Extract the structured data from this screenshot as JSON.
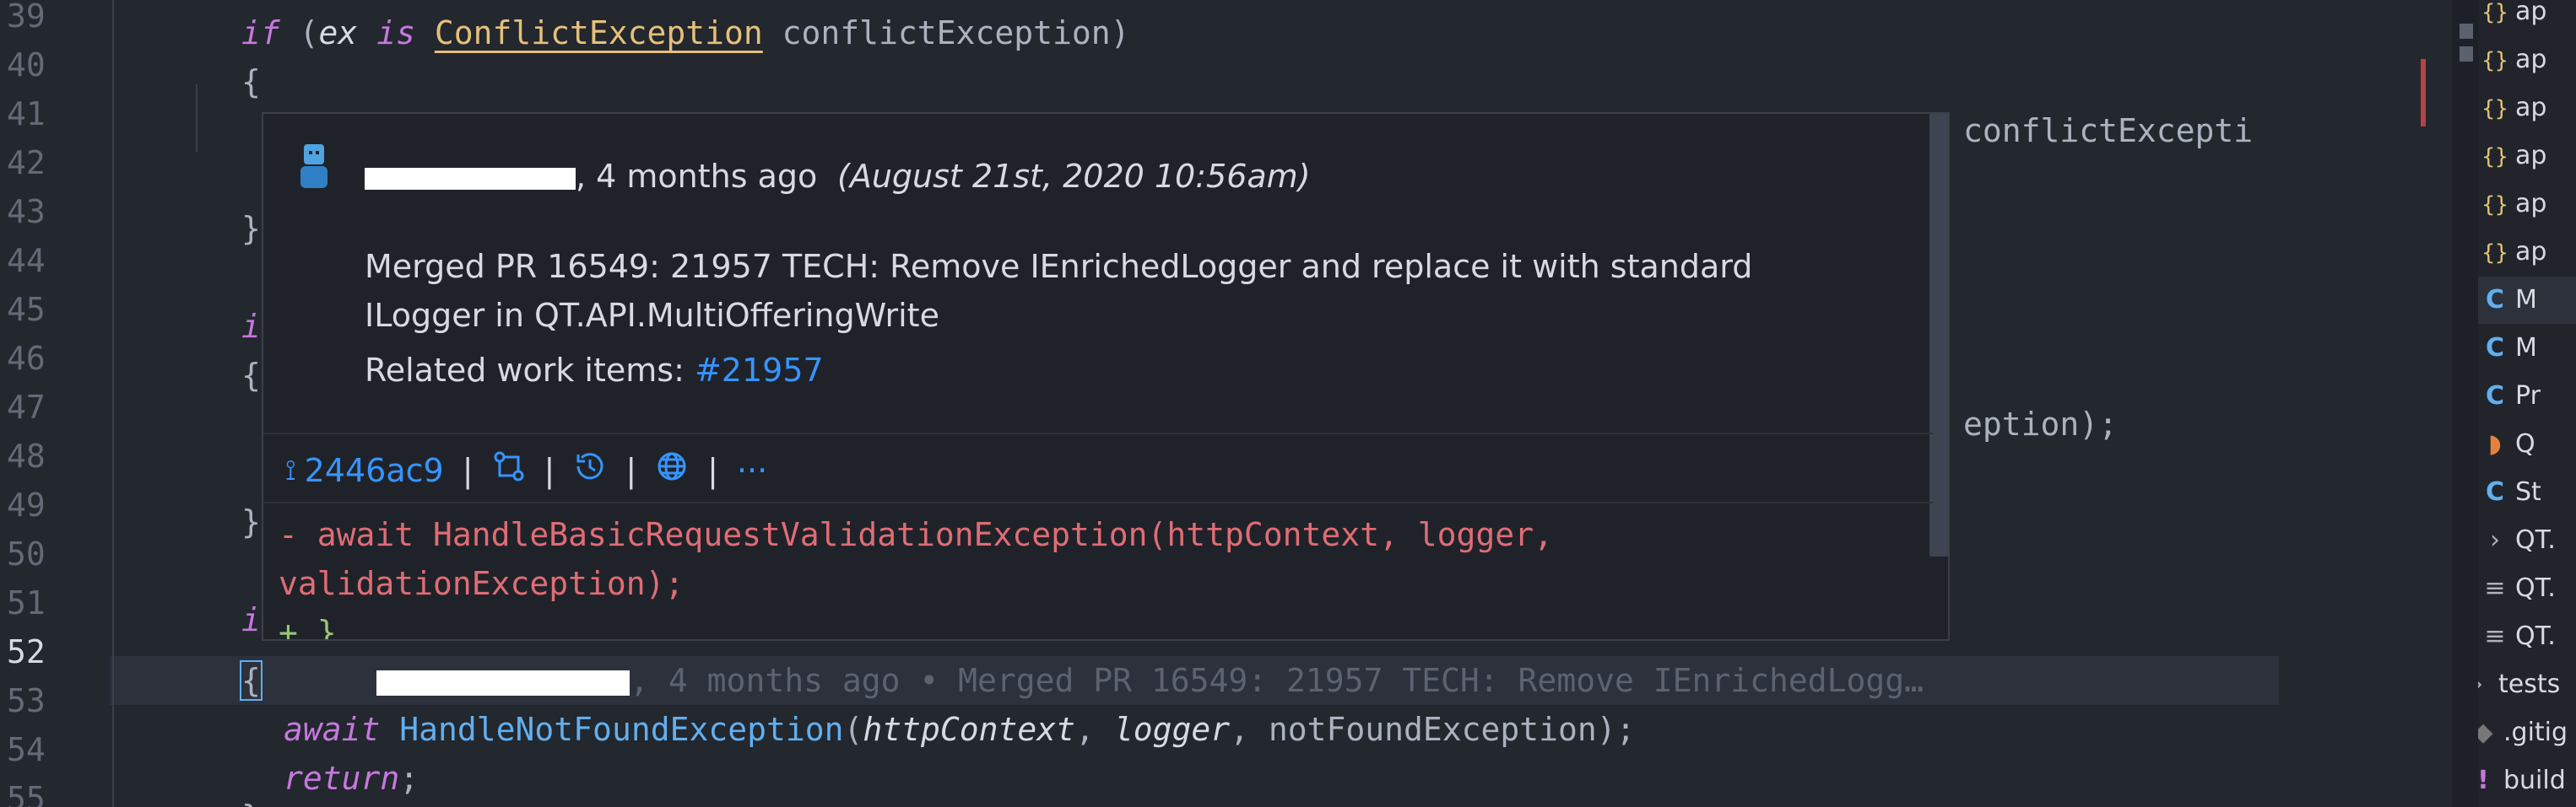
{
  "gutter": {
    "lines": [
      "39",
      "40",
      "41",
      "42",
      "43",
      "44",
      "45",
      "46",
      "47",
      "48",
      "49",
      "50",
      "51",
      "52",
      "53",
      "54",
      "55"
    ]
  },
  "code": {
    "l39": {
      "if_kw": "if",
      "open": " (",
      "ex": "ex",
      "is_kw": "is",
      "type": "ConflictException",
      "rest": " conflictException)"
    },
    "l40": "{",
    "l41_tail": "conflictExcepti",
    "l43": "}",
    "l45_kw": "i",
    "l46": "{",
    "l47_tail": "eption);",
    "l49": "}",
    "l51_kw": "i",
    "l52": {
      "brace": "{",
      "blame_tail": ", 4 months ago • Merged PR 16549: 21957 TECH: Remove IEnrichedLogg…"
    },
    "l53": {
      "await_kw": "await",
      "fn": "HandleNotFoundException",
      "p1": "httpContext",
      "p2": "logger",
      "p3": "notFoundException",
      "end": ");"
    },
    "l54": {
      "return_kw": "return",
      "end": ";"
    },
    "l55": "}"
  },
  "hover": {
    "author_suffix": ", 4 months ago",
    "date": "(August 21st, 2020 10:56am)",
    "message": "Merged PR 16549: 21957 TECH: Remove IEnrichedLogger and replace it with standard ILogger in QT.API.MultiOfferingWrite",
    "related_label": "Related work items: ",
    "related_link": "#21957",
    "commit_hash": "2446ac9",
    "actions": {
      "sep": "|",
      "more": "···"
    },
    "diff": {
      "removed_1": "- await HandleBasicRequestValidationException(httpContext, logger,",
      "removed_2": "validationException);",
      "added": "+ }"
    }
  },
  "explorer": {
    "items": [
      {
        "icon": "{}",
        "kind": "json-icon",
        "label": "ap"
      },
      {
        "icon": "{}",
        "kind": "json-icon",
        "label": "ap"
      },
      {
        "icon": "{}",
        "kind": "json-icon",
        "label": "ap"
      },
      {
        "icon": "{}",
        "kind": "json-icon",
        "label": "ap"
      },
      {
        "icon": "{}",
        "kind": "json-icon",
        "label": "ap"
      },
      {
        "icon": "{}",
        "kind": "json-icon",
        "label": "ap"
      },
      {
        "icon": "C",
        "kind": "csharp-icon",
        "label": "M"
      },
      {
        "icon": "C",
        "kind": "csharp-icon",
        "label": "M"
      },
      {
        "icon": "C",
        "kind": "csharp-icon",
        "label": "Pr"
      },
      {
        "icon": "◗",
        "kind": "rss-icon",
        "label": "Q"
      },
      {
        "icon": "C",
        "kind": "csharp-icon",
        "label": "St"
      },
      {
        "icon": "›",
        "kind": "chevron-right-icon",
        "label": "QT."
      },
      {
        "icon": "≡",
        "kind": "lines-icon",
        "label": "QT."
      },
      {
        "icon": "≡",
        "kind": "lines-icon",
        "label": "QT."
      },
      {
        "icon": "›",
        "kind": "chevron-right-icon",
        "label": "tests"
      },
      {
        "icon": "◆",
        "kind": "git-icon",
        "label": ".gitig"
      },
      {
        "icon": "!",
        "kind": "bang-icon",
        "label": "build"
      }
    ]
  },
  "colors": {
    "background": "#23272e",
    "keyword": "#c678dd",
    "type": "#e5c07b",
    "function": "#61afef",
    "link": "#3794ff",
    "removed": "#e06c75",
    "added": "#98c379"
  }
}
